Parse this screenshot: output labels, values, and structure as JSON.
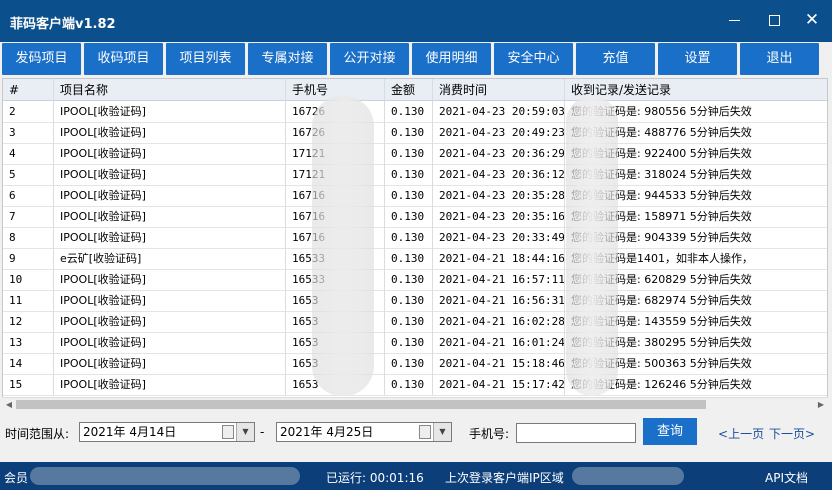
{
  "window": {
    "title": "菲码客户端v1.82",
    "controls": [
      "minimize",
      "maximize",
      "close"
    ]
  },
  "toolbar": {
    "buttons": [
      "发码项目",
      "收码项目",
      "项目列表",
      "专属对接",
      "公开对接",
      "使用明细",
      "安全中心",
      "充值",
      "设置",
      "退出"
    ]
  },
  "table": {
    "columns": [
      "#",
      "项目名称",
      "手机号",
      "金额",
      "消费时间",
      "收到记录/发送记录"
    ],
    "rows": [
      {
        "num": "2",
        "name": "IPOOL[收验证码]",
        "phone": "16726",
        "amount": "0.130",
        "time": "2021-04-23 20:59:03",
        "record": "您的验证码是: 980556  5分钟后失效"
      },
      {
        "num": "3",
        "name": "IPOOL[收验证码]",
        "phone": "16726",
        "amount": "0.130",
        "time": "2021-04-23 20:49:23",
        "record": "您的验证码是: 488776  5分钟后失效"
      },
      {
        "num": "4",
        "name": "IPOOL[收验证码]",
        "phone": "17121",
        "amount": "0.130",
        "time": "2021-04-23 20:36:29",
        "record": "您的验证码是: 922400  5分钟后失效"
      },
      {
        "num": "5",
        "name": "IPOOL[收验证码]",
        "phone": "17121",
        "amount": "0.130",
        "time": "2021-04-23 20:36:12",
        "record": "您的验证码是: 318024  5分钟后失效"
      },
      {
        "num": "6",
        "name": "IPOOL[收验证码]",
        "phone": "16716",
        "amount": "0.130",
        "time": "2021-04-23 20:35:28",
        "record": "您的验证码是: 944533  5分钟后失效"
      },
      {
        "num": "7",
        "name": "IPOOL[收验证码]",
        "phone": "16716",
        "amount": "0.130",
        "time": "2021-04-23 20:35:16",
        "record": "您的验证码是: 158971  5分钟后失效"
      },
      {
        "num": "8",
        "name": "IPOOL[收验证码]",
        "phone": "16716",
        "amount": "0.130",
        "time": "2021-04-23 20:33:49",
        "record": "您的验证码是: 904339  5分钟后失效"
      },
      {
        "num": "9",
        "name": "e云矿[收验证码]",
        "phone": "16533",
        "amount": "0.130",
        "time": "2021-04-21 18:44:16",
        "record": "您的验证码是1401，如非本人操作，"
      },
      {
        "num": "10",
        "name": "IPOOL[收验证码]",
        "phone": "16533",
        "amount": "0.130",
        "time": "2021-04-21 16:57:11",
        "record": "您的验证码是: 620829  5分钟后失效"
      },
      {
        "num": "11",
        "name": "IPOOL[收验证码]",
        "phone": "1653",
        "amount": "0.130",
        "time": "2021-04-21 16:56:31",
        "record": "您的验证码是: 682974  5分钟后失效"
      },
      {
        "num": "12",
        "name": "IPOOL[收验证码]",
        "phone": "1653",
        "amount": "0.130",
        "time": "2021-04-21 16:02:28",
        "record": "您的验证码是: 143559  5分钟后失效"
      },
      {
        "num": "13",
        "name": "IPOOL[收验证码]",
        "phone": "1653",
        "amount": "0.130",
        "time": "2021-04-21 16:01:24",
        "record": "您的验证码是: 380295  5分钟后失效"
      },
      {
        "num": "14",
        "name": "IPOOL[收验证码]",
        "phone": "1653",
        "amount": "0.130",
        "time": "2021-04-21 15:18:46",
        "record": "您的验证码是: 500363  5分钟后失效"
      },
      {
        "num": "15",
        "name": "IPOOL[收验证码]",
        "phone": "1653",
        "amount": "0.130",
        "time": "2021-04-21 15:17:42",
        "record": "您的验证码是: 126246  5分钟后失效"
      }
    ]
  },
  "filter": {
    "range_label": "时间范围从:",
    "start_date": "2021年  4月14日",
    "separator": "-",
    "end_date": "2021年  4月25日",
    "phone_label": "手机号:",
    "phone_value": "",
    "query_label": "查询",
    "prev_label": "上一页",
    "next_label": "下一页"
  },
  "status": {
    "member_label": "会员",
    "uptime": "已运行: 00:01:16",
    "last_login": "上次登录客户端IP区域",
    "api_doc": "API文档"
  },
  "colors": {
    "titlebar": "#0b4f8c",
    "button": "#1a6fc9",
    "statusbar": "#0c3f7a",
    "link": "#1a4d9a"
  }
}
